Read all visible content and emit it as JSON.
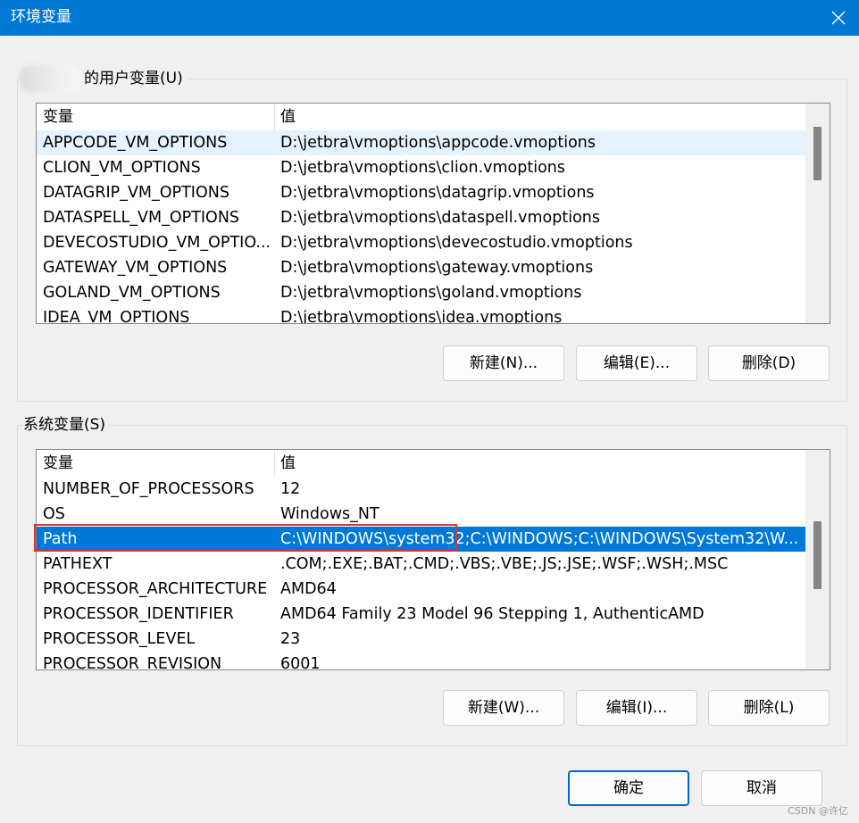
{
  "window": {
    "title": "环境变量"
  },
  "icons": {
    "close": "close-icon"
  },
  "user_vars": {
    "group_label": "的用户变量(U)",
    "columns": [
      "变量",
      "值"
    ],
    "rows": [
      {
        "name": "APPCODE_VM_OPTIONS",
        "value": "D:\\jetbra\\vmoptions\\appcode.vmoptions"
      },
      {
        "name": "CLION_VM_OPTIONS",
        "value": "D:\\jetbra\\vmoptions\\clion.vmoptions"
      },
      {
        "name": "DATAGRIP_VM_OPTIONS",
        "value": "D:\\jetbra\\vmoptions\\datagrip.vmoptions"
      },
      {
        "name": "DATASPELL_VM_OPTIONS",
        "value": "D:\\jetbra\\vmoptions\\dataspell.vmoptions"
      },
      {
        "name": "DEVECOSTUDIO_VM_OPTIO...",
        "value": "D:\\jetbra\\vmoptions\\devecostudio.vmoptions"
      },
      {
        "name": "GATEWAY_VM_OPTIONS",
        "value": "D:\\jetbra\\vmoptions\\gateway.vmoptions"
      },
      {
        "name": "GOLAND_VM_OPTIONS",
        "value": "D:\\jetbra\\vmoptions\\goland.vmoptions"
      },
      {
        "name": "IDEA_VM_OPTIONS",
        "value": "D:\\jetbra\\vmoptions\\idea.vmoptions"
      }
    ],
    "buttons": {
      "new": "新建(N)...",
      "edit": "编辑(E)...",
      "delete": "删除(D)"
    }
  },
  "system_vars": {
    "group_label": "系统变量(S)",
    "columns": [
      "变量",
      "值"
    ],
    "rows": [
      {
        "name": "NUMBER_OF_PROCESSORS",
        "value": "12"
      },
      {
        "name": "OS",
        "value": "Windows_NT"
      },
      {
        "name": "Path",
        "value": "C:\\WINDOWS\\system32;C:\\WINDOWS;C:\\WINDOWS\\System32\\W..."
      },
      {
        "name": "PATHEXT",
        "value": ".COM;.EXE;.BAT;.CMD;.VBS;.VBE;.JS;.JSE;.WSF;.WSH;.MSC"
      },
      {
        "name": "PROCESSOR_ARCHITECTURE",
        "value": "AMD64"
      },
      {
        "name": "PROCESSOR_IDENTIFIER",
        "value": "AMD64 Family 23 Model 96 Stepping 1, AuthenticAMD"
      },
      {
        "name": "PROCESSOR_LEVEL",
        "value": "23"
      },
      {
        "name": "PROCESSOR_REVISION",
        "value": "6001"
      }
    ],
    "buttons": {
      "new": "新建(W)...",
      "edit": "编辑(I)...",
      "delete": "删除(L)"
    }
  },
  "footer": {
    "ok": "确定",
    "cancel": "取消"
  },
  "watermark": "CSDN @许亿",
  "colors": {
    "titlebar": "#0078d4",
    "selection": "#0078d7",
    "annotation": "#e1322d"
  }
}
